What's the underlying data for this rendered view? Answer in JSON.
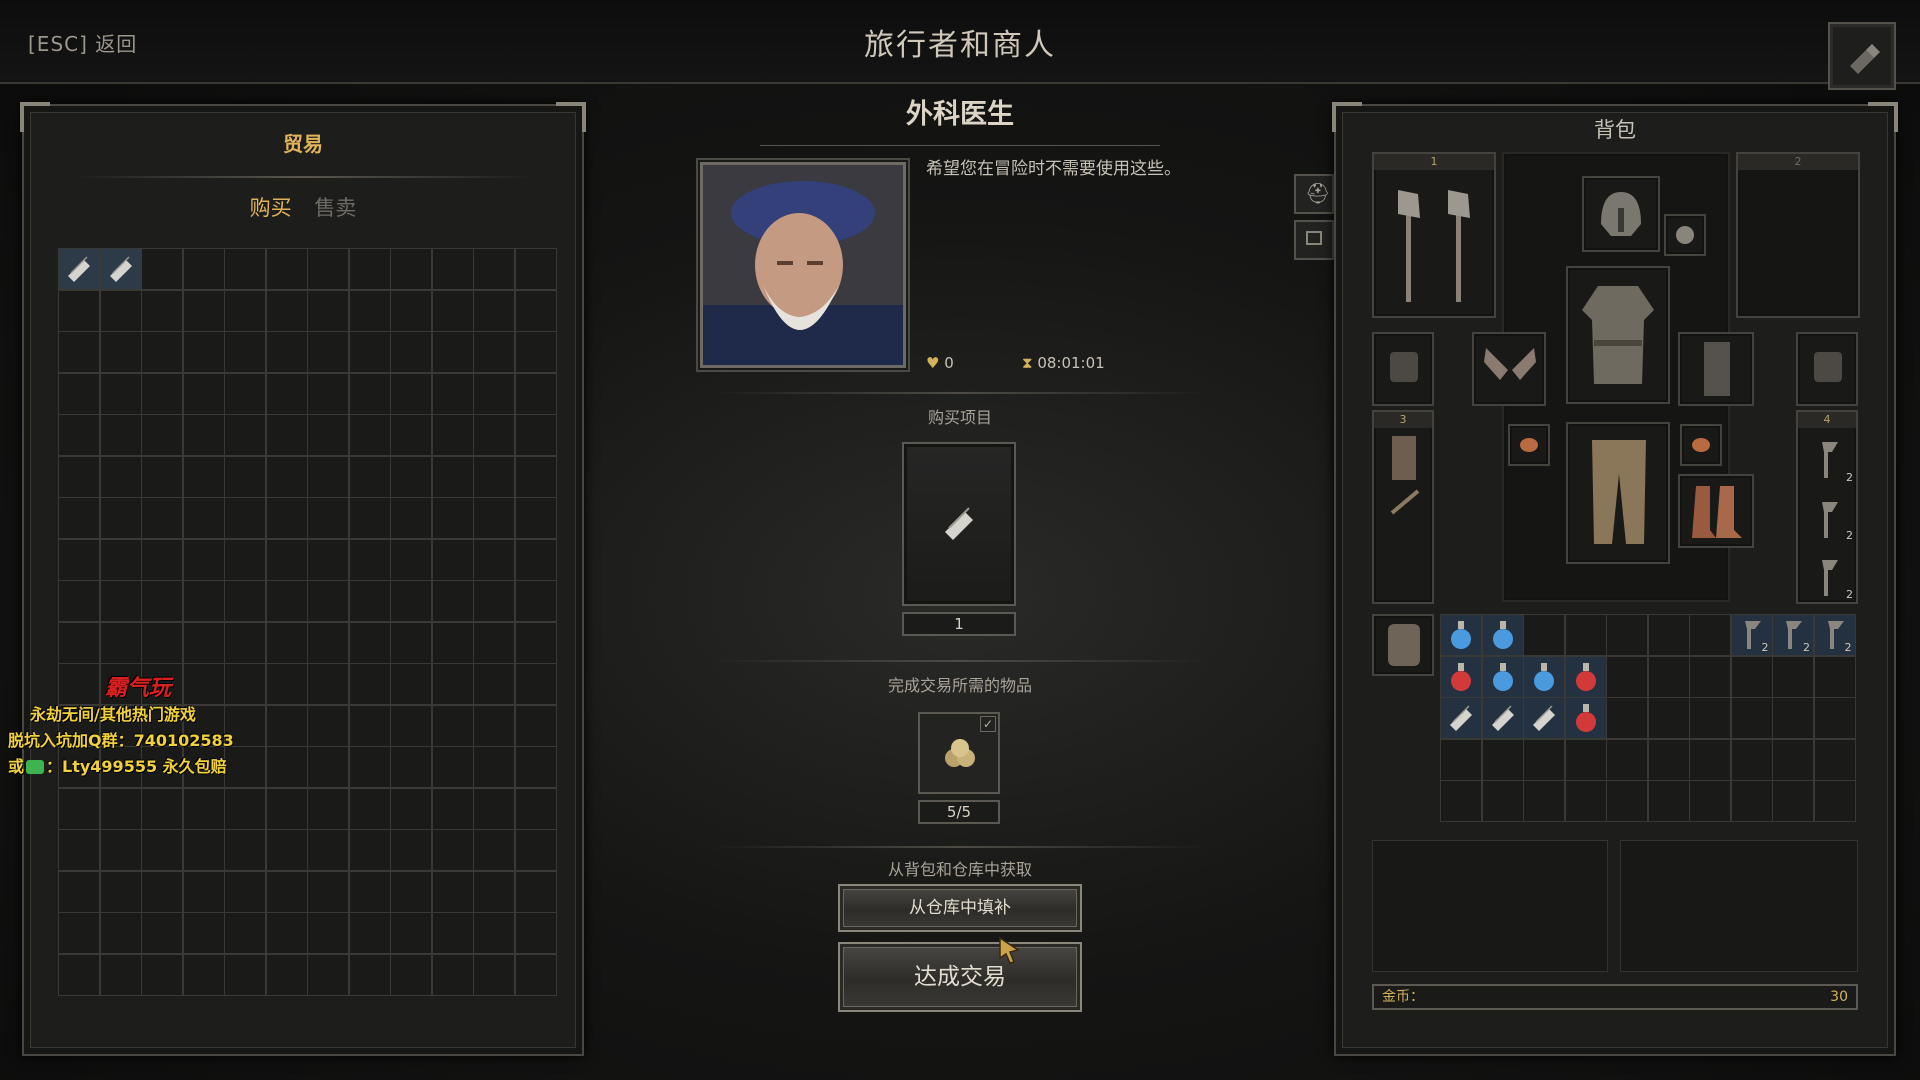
{
  "header": {
    "back_label": "[ESC] 返回",
    "title": "旅行者和商人"
  },
  "trade": {
    "title": "贸易",
    "tabs": [
      {
        "label": "购买",
        "active": true
      },
      {
        "label": "售卖",
        "active": false
      }
    ],
    "grid_items": [
      "bandage-icon",
      "bandage-icon"
    ]
  },
  "npc": {
    "name": "外科医生",
    "greeting": "希望您在冒险时不需要使用这些。",
    "reputation": "0",
    "timer": "08:01:01",
    "buy_section_label": "购买项目",
    "buy_item": {
      "icon": "bandage-icon",
      "quantity": "1"
    },
    "required_section_label": "完成交易所需的物品",
    "required_item": {
      "icon": "gold-coins-icon",
      "quantity": "5/5",
      "checked": true
    },
    "source_label": "从背包和仓库中获取",
    "fill_button": "从仓库中填补",
    "trade_button": "达成交易"
  },
  "backpack": {
    "title": "背包",
    "weapon_set_1": "1",
    "weapon_set_2": "2",
    "belt_slot_3": "3",
    "belt_slot_4": "4",
    "throwing_axe_counts": [
      "2",
      "2",
      "2"
    ],
    "inventory_axe_counts": [
      "2",
      "2",
      "2"
    ],
    "gold_label": "金币：",
    "gold_value": "30"
  },
  "watermark": {
    "logo": "霸气玩",
    "line1": "永劫无间/其他热门游戏",
    "line2": "脱坑入坑加Q群：740102583",
    "line3": "或",
    "line3_rest": "：Lty499555 永久包赔"
  },
  "colors": {
    "accent_gold": "#e0b35a",
    "panel_bg": "#1d1d1c",
    "border": "#4a4742"
  }
}
